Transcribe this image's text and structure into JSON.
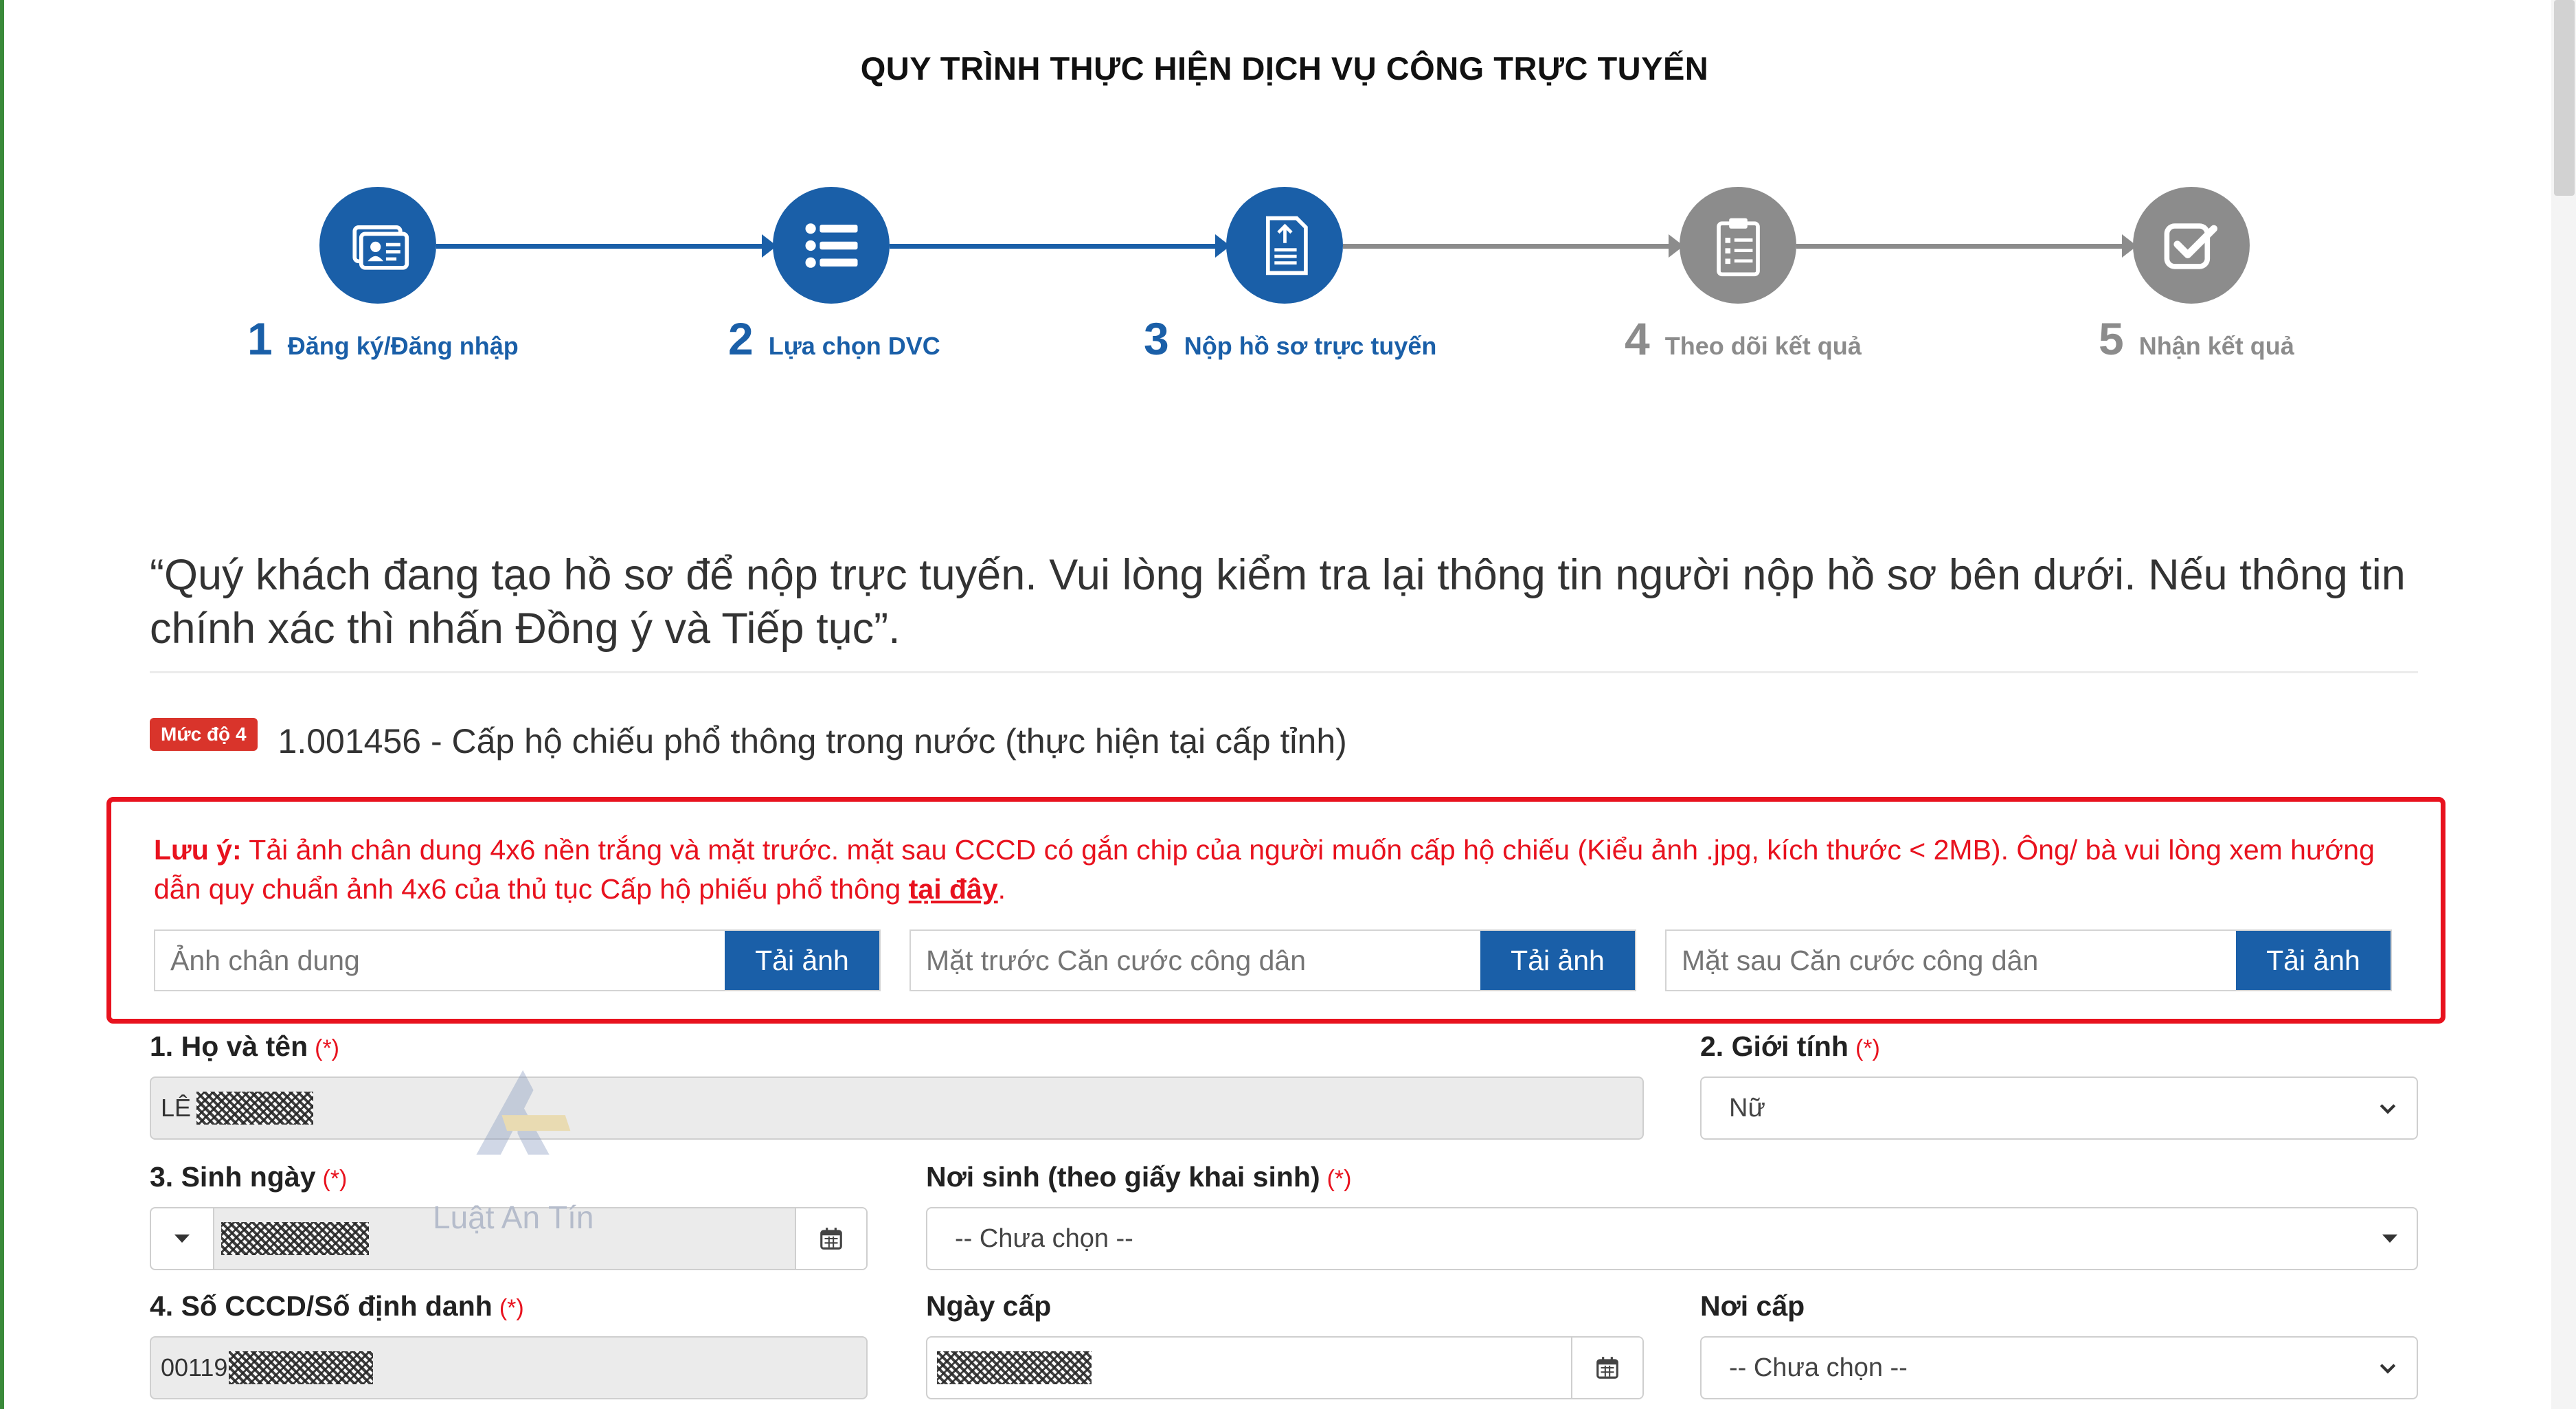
{
  "page": {
    "title": "QUY TRÌNH THỰC HIỆN DỊCH VỤ CÔNG TRỰC TUYẾN"
  },
  "steps": [
    {
      "num": "1",
      "label": "Đăng ký/Đăng nhập",
      "icon": "id-card-icon",
      "state": "active"
    },
    {
      "num": "2",
      "label": "Lựa chọn DVC",
      "icon": "list-icon",
      "state": "active"
    },
    {
      "num": "3",
      "label": "Nộp hồ sơ trực tuyến",
      "icon": "document-upload-icon",
      "state": "active"
    },
    {
      "num": "4",
      "label": "Theo dõi kết quả",
      "icon": "clipboard-icon",
      "state": "inactive"
    },
    {
      "num": "5",
      "label": "Nhận kết quả",
      "icon": "checkbox-icon",
      "state": "inactive"
    }
  ],
  "colors": {
    "active": "#1a5fa8",
    "inactive": "#8c8c8c",
    "alert": "#e8121e",
    "badge": "#d9342b"
  },
  "notice": "“Quý khách đang tạo hồ sơ để nộp trực tuyến. Vui lòng kiểm tra lại thông tin người nộp hồ sơ bên dưới. Nếu thông tin chính xác thì nhấn Đồng ý và Tiếp tục”.",
  "service": {
    "badge": "Mức độ 4",
    "title": "1.001456 - Cấp hộ chiếu phổ thông trong nước (thực hiện tại cấp tỉnh)"
  },
  "alert": {
    "prefix": "Lưu ý:",
    "text": " Tải ảnh chân dung 4x6 nền trắng và mặt trước. mặt sau CCCD có gắn chip của người muốn cấp hộ chiếu (Kiểu ảnh .jpg, kích thước < 2MB). Ông/ bà vui lòng xem hướng dẫn quy chuẩn ảnh 4x6 của thủ tục Cấp hộ phiếu phổ thông ",
    "link": "tại đây",
    "suffix": "."
  },
  "uploads": [
    {
      "placeholder": "Ảnh chân dung",
      "button": "Tải ảnh"
    },
    {
      "placeholder": "Mặt trước Căn cước công dân",
      "button": "Tải ảnh"
    },
    {
      "placeholder": "Mặt sau Căn cước công dân",
      "button": "Tải ảnh"
    }
  ],
  "form": {
    "required_mark": "(*)",
    "full_name": {
      "label": "1. Họ và tên",
      "value": "LÊ"
    },
    "gender": {
      "label": "2. Giới tính",
      "value": "Nữ"
    },
    "birth_date": {
      "label": "3. Sinh ngày"
    },
    "birth_place": {
      "label": "Nơi sinh (theo giấy khai sinh)",
      "value": "-- Chưa chọn --"
    },
    "id_number": {
      "label": "4. Số CCCD/Số định danh",
      "value": "00119"
    },
    "issue_date": {
      "label": "Ngày cấp"
    },
    "issue_place": {
      "label": "Nơi cấp",
      "value": "-- Chưa chọn --"
    }
  },
  "watermark": {
    "text": "Luật An Tín"
  }
}
